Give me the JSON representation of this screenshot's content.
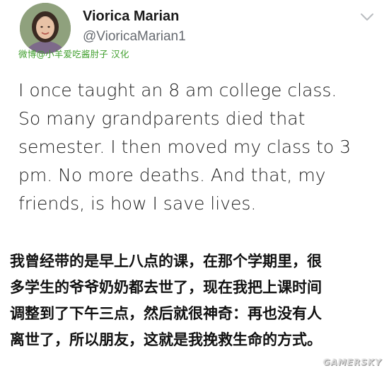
{
  "profile": {
    "display_name": "Viorica Marian",
    "handle": "@VioricaMarian1",
    "avatar_icon": "avatar-photo"
  },
  "menu": {
    "icon": "chevron-down-icon"
  },
  "credit": "微博@小羊爱吃酱肘子 汉化",
  "tweet": {
    "lines": [
      "I once taught an 8 am college class.",
      "So many grandparents died that",
      "semester. I then moved my class to 3",
      "pm. No more deaths. And that, my",
      "friends, is how I save lives."
    ]
  },
  "translation": {
    "lines": [
      "我曾经带的是早上八点的课，在那个学期里，很",
      "多学生的爷爷奶奶都去世了，现在我把上课时间",
      "调整到了下午三点，然后就很神奇：再也没有人",
      "离世了，所以朋友，这就是我挽救生命的方式。"
    ]
  },
  "watermark": "GAMERSKY"
}
